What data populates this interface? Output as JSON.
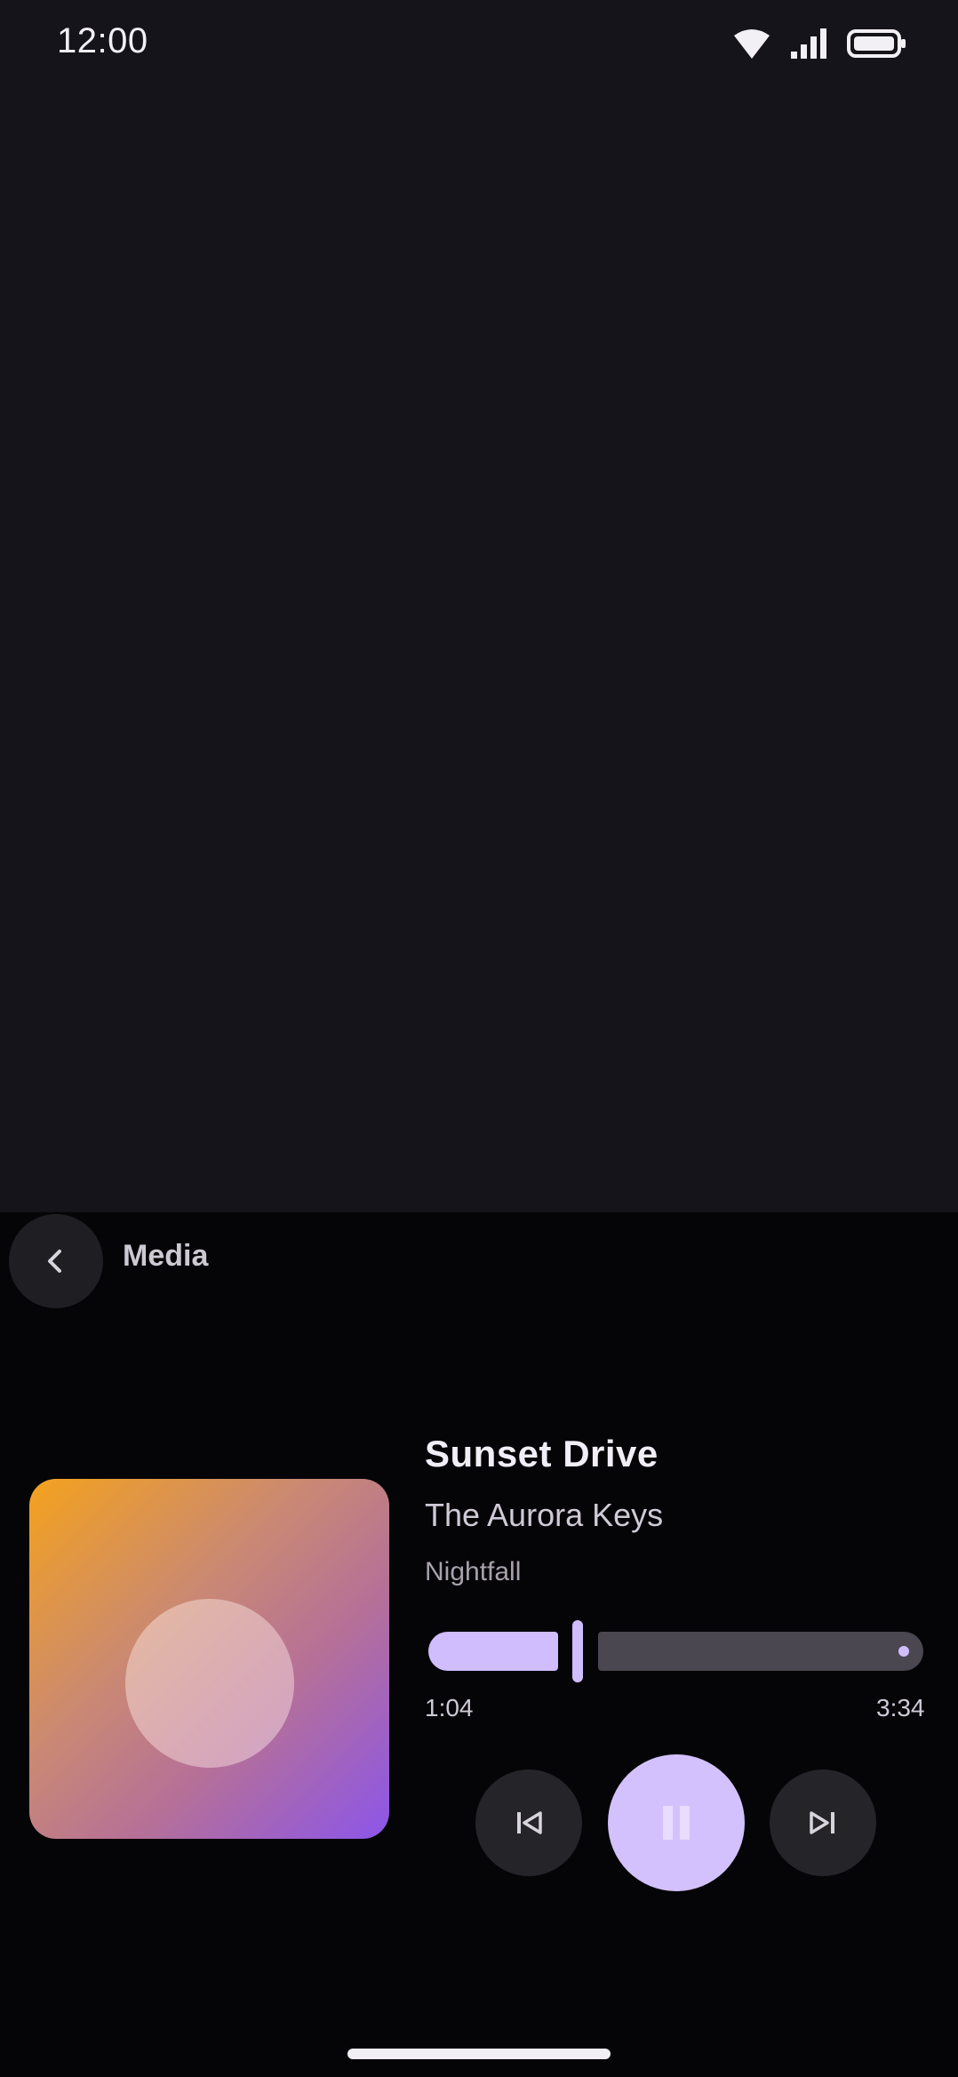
{
  "status_bar": {
    "time": "12:00",
    "icons": [
      "wifi-icon",
      "signal-icon",
      "battery-icon"
    ]
  },
  "panel": {
    "title": "Media",
    "back_icon": "chevron-left-icon"
  },
  "now_playing": {
    "title": "Sunset Drive",
    "artist": "The Aurora Keys",
    "album": "Nightfall",
    "elapsed": "1:04",
    "duration": "3:34",
    "progress_fraction": 0.3
  },
  "controls": {
    "previous_icon": "skip-previous-icon",
    "play_pause_icon": "pause-icon",
    "next_icon": "skip-next-icon"
  },
  "colors": {
    "background": "#16141b",
    "panel_background": "#050407",
    "accent": "#cfbdfe",
    "track_inactive": "#4a4750",
    "album_gradient_start": "#f4a21d",
    "album_gradient_end": "#8c55ea"
  }
}
